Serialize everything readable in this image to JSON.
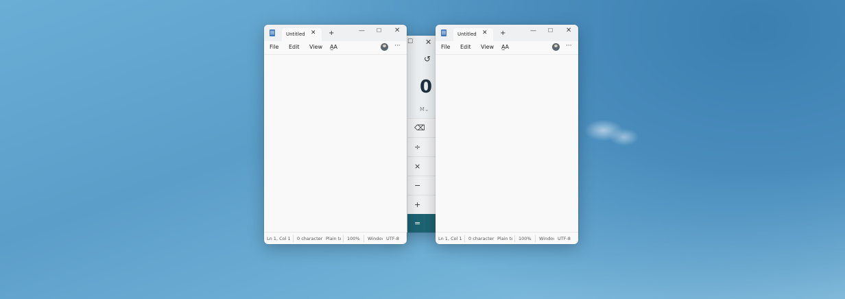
{
  "calculator": {
    "max_glyph": "☐",
    "close_glyph": "✕",
    "history_glyph": "↺",
    "display_value": "0",
    "memory_label": "M⌄",
    "operators": [
      "⌫",
      "÷",
      "×",
      "−",
      "+",
      "="
    ]
  },
  "notepads": [
    {
      "tab_title": "Untitled",
      "tab_close": "✕",
      "new_tab": "+",
      "minimize": "—",
      "maximize": "☐",
      "close": "✕",
      "menu": {
        "file": "File",
        "edit": "Edit",
        "view": "View",
        "font": "A̲A"
      },
      "more": "···",
      "status": {
        "position": "Ln 1, Col 1",
        "chars": "0 character",
        "format": "Plain text",
        "zoom": "100%",
        "line_ending": "Windows (CRLF)",
        "encoding": "UTF-8"
      }
    },
    {
      "tab_title": "Untitled",
      "tab_close": "✕",
      "new_tab": "+",
      "minimize": "—",
      "maximize": "☐",
      "close": "✕",
      "menu": {
        "file": "File",
        "edit": "Edit",
        "view": "View",
        "font": "A̲A"
      },
      "more": "···",
      "status": {
        "position": "Ln 1, Col 1",
        "chars": "0 character",
        "format": "Plain text",
        "zoom": "100%",
        "line_ending": "Windows (CRLF)",
        "encoding": "UTF-8"
      }
    }
  ]
}
